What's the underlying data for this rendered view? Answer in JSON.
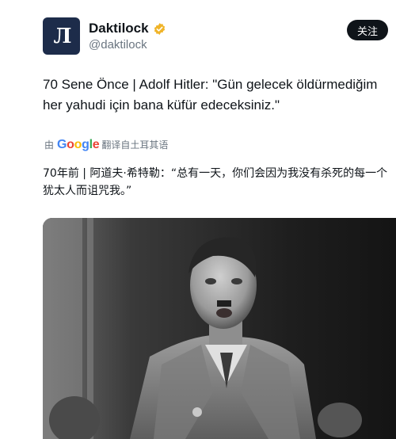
{
  "author": {
    "avatar_icon": "typewriter-logo-icon",
    "avatar_mark": "Л",
    "display_name": "Daktilock",
    "handle": "@daktilock",
    "verified_badge": "verified-gold-icon"
  },
  "follow_label": "关注",
  "tweet": {
    "text": "70 Sene Önce | Adolf Hitler: \"Gün gelecek öldürmediğim her yahudi için bana küfür edeceksiniz.\""
  },
  "translation": {
    "prefix": "由",
    "google": [
      "G",
      "o",
      "o",
      "g",
      "l",
      "e"
    ],
    "suffix": "翻译自土耳其语",
    "text": "70年前 | 阿道夫·希特勒：“总有一天，你们会因为我没有杀死的每一个犹太人而诅咒我。”"
  },
  "media": {
    "description_icon": "black-and-white-photo"
  },
  "colors": {
    "follow_bg": "#0f1419",
    "avatar_bg": "#1d2c4a",
    "muted_text": "#6a7580",
    "verified": "#f0b429"
  }
}
